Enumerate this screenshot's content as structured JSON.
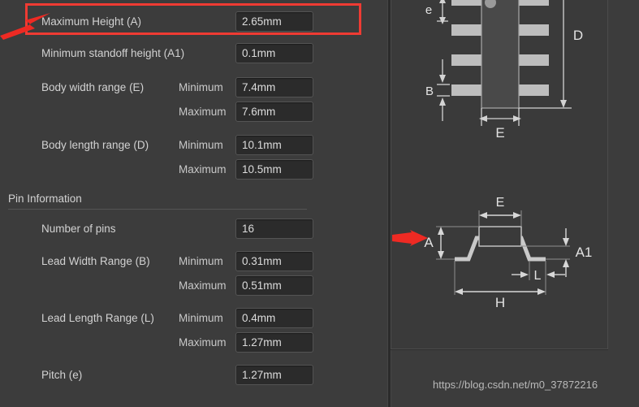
{
  "panel": {
    "group_header": "Pin Information"
  },
  "fields": [
    {
      "label": "Maximum Height (A)",
      "sub": "",
      "value": "2.65mm",
      "name": "maximum-height-a"
    },
    {
      "label": "Minimum standoff height (A1)",
      "sub": "",
      "value": "0.1mm",
      "name": "minimum-standoff-height-a1"
    },
    {
      "label": "Body width range (E)",
      "sub": "Minimum",
      "value": "7.4mm",
      "name": "body-width-range-e-minimum"
    },
    {
      "label": "",
      "sub": "Maximum",
      "value": "7.6mm",
      "name": "body-width-range-e-maximum"
    },
    {
      "label": "Body length range (D)",
      "sub": "Minimum",
      "value": "10.1mm",
      "name": "body-length-range-d-minimum"
    },
    {
      "label": "",
      "sub": "Maximum",
      "value": "10.5mm",
      "name": "body-length-range-d-maximum"
    },
    {
      "label": "Number of pins",
      "sub": "",
      "value": "16",
      "name": "number-of-pins"
    },
    {
      "label": "Lead Width Range (B)",
      "sub": "Minimum",
      "value": "0.31mm",
      "name": "lead-width-range-b-minimum"
    },
    {
      "label": "",
      "sub": "Maximum",
      "value": "0.51mm",
      "name": "lead-width-range-b-maximum"
    },
    {
      "label": "Lead Length Range (L)",
      "sub": "Minimum",
      "value": "0.4mm",
      "name": "lead-length-range-l-minimum"
    },
    {
      "label": "",
      "sub": "Maximum",
      "value": "1.27mm",
      "name": "lead-length-range-l-maximum"
    },
    {
      "label": "Pitch (e)",
      "sub": "",
      "value": "1.27mm",
      "name": "pitch-e"
    }
  ],
  "diagram": {
    "top_view_labels": {
      "e": "e",
      "B": "B",
      "D": "D",
      "E": "E"
    },
    "side_view_labels": {
      "E": "E",
      "A": "A",
      "A1": "A1",
      "L": "L",
      "H": "H"
    }
  },
  "annotation": {
    "highlight_color": "#ef3b33",
    "arrow_color": "#ee2a23"
  },
  "watermark": "https://blog.csdn.net/m0_37872216"
}
